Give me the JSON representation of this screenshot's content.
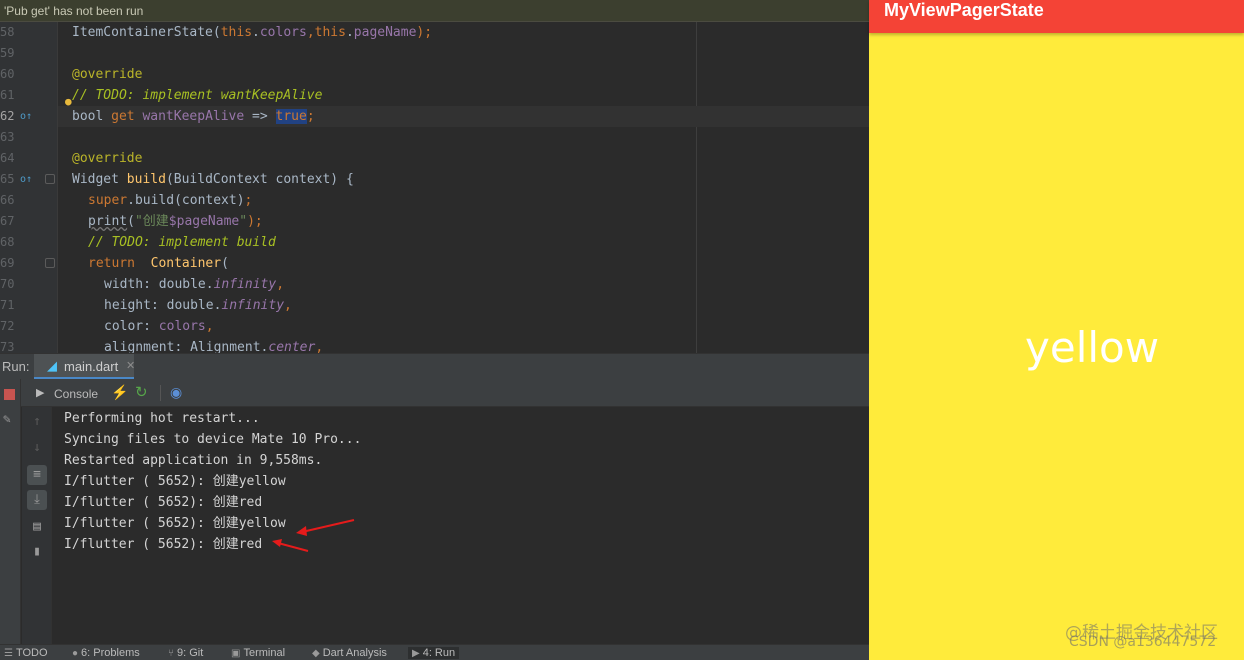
{
  "notice": {
    "text": "'Pub get' has not been run"
  },
  "editor": {
    "lines": [
      {
        "num": "58"
      },
      {
        "num": "59"
      },
      {
        "num": "60"
      },
      {
        "num": "61"
      },
      {
        "num": "62"
      },
      {
        "num": "63"
      },
      {
        "num": "64"
      },
      {
        "num": "65"
      },
      {
        "num": "66"
      },
      {
        "num": "67"
      },
      {
        "num": "68"
      },
      {
        "num": "69"
      },
      {
        "num": "70"
      },
      {
        "num": "71"
      },
      {
        "num": "72"
      },
      {
        "num": "73"
      }
    ],
    "code": {
      "l58a": "ItemContainerState(",
      "l58b": "this",
      "l58c": ".",
      "l58d": "colors",
      "l58e": ",",
      "l58f": "this",
      "l58g": ".",
      "l58h": "pageName",
      "l58i": ");",
      "l60": "@override",
      "l61": "// TODO: implement wantKeepAlive",
      "l62a": "bool ",
      "l62b": "get ",
      "l62c": "wantKeepAlive",
      "l62d": " => ",
      "l62e": "true",
      "l62f": ";",
      "l64": "@override",
      "l65a": "Widget ",
      "l65b": "build",
      "l65c": "(BuildContext context) {",
      "l66a": "super",
      "l66b": ".build(context)",
      "l66c": ";",
      "l67a": "print",
      "l67b": "(",
      "l67c": "\"创建",
      "l67d": "$pageName",
      "l67e": "\"",
      "l67f": ");",
      "l68": "// TODO: implement build",
      "l69a": "return  ",
      "l69b": "Container",
      "l69c": "(",
      "l70a": "width: double.",
      "l70b": "infinity",
      "l70c": ",",
      "l71a": "height: double.",
      "l71b": "infinity",
      "l71c": ",",
      "l72a": "color: ",
      "l72b": "colors",
      "l72c": ",",
      "l73a": "alignment: Alignment.",
      "l73b": "center",
      "l73c": ","
    }
  },
  "run": {
    "label": "Run:",
    "tab_label": "main.dart",
    "console_label": "Console",
    "output": [
      "Performing hot restart...",
      "Syncing files to device Mate 10 Pro...",
      "Restarted application in 9,558ms.",
      "I/flutter ( 5652): 创建yellow",
      "I/flutter ( 5652): 创建red",
      "I/flutter ( 5652): 创建yellow",
      "I/flutter ( 5652): 创建red"
    ]
  },
  "statusbar": {
    "todo": "TODO",
    "problems": "6: Problems",
    "git": "9: Git",
    "terminal": "Terminal",
    "dart_analysis": "Dart Analysis",
    "run": "4: Run"
  },
  "phone": {
    "appbar_title": "MyViewPagerState",
    "page_text": "yellow",
    "appbar_color": "#f44336",
    "page_color": "#ffeb3b"
  },
  "watermark": {
    "line1": "@稀土掘金技术社区",
    "line2": "CSDN @a136447572"
  },
  "colors": {
    "arrow": "#e51b1b",
    "selection": "#214283"
  }
}
